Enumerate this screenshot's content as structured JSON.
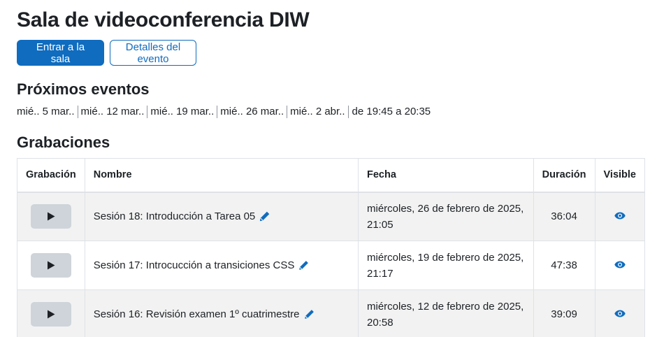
{
  "page": {
    "title": "Sala de videoconferencia DIW"
  },
  "actions": {
    "join_label": "Entrar a la sala",
    "details_label": "Detalles del evento"
  },
  "upcoming": {
    "heading": "Próximos eventos",
    "dates": [
      "mié.. 5 mar..",
      "mié.. 12 mar..",
      "mié.. 19 mar..",
      "mié.. 26 mar..",
      "mié.. 2 abr.."
    ],
    "time": "de 19:45 a 20:35"
  },
  "recordings": {
    "heading": "Grabaciones",
    "columns": {
      "recording": "Grabación",
      "name": "Nombre",
      "date": "Fecha",
      "duration": "Duración",
      "visible": "Visible"
    },
    "rows": [
      {
        "name": "Sesión 18: Introducción a Tarea 05",
        "date_line1": "miércoles, 26 de febrero de 2025,",
        "date_line2": "21:05",
        "duration": "36:04"
      },
      {
        "name": "Sesión 17: Introcucción a transiciones CSS",
        "date_line1": "miércoles, 19 de febrero de 2025,",
        "date_line2": "21:17",
        "duration": "47:38"
      },
      {
        "name": "Sesión 16: Revisión examen 1º cuatrimestre",
        "date_line1": "miércoles, 12 de febrero de 2025,",
        "date_line2": "20:58",
        "duration": "39:09"
      }
    ]
  },
  "icons": {
    "play": "play-icon",
    "edit": "pencil-icon",
    "visible": "eye-icon"
  },
  "colors": {
    "accent": "#0f6cbf",
    "play_button_bg": "#ced4da",
    "row_stripe": "#f2f2f2"
  }
}
